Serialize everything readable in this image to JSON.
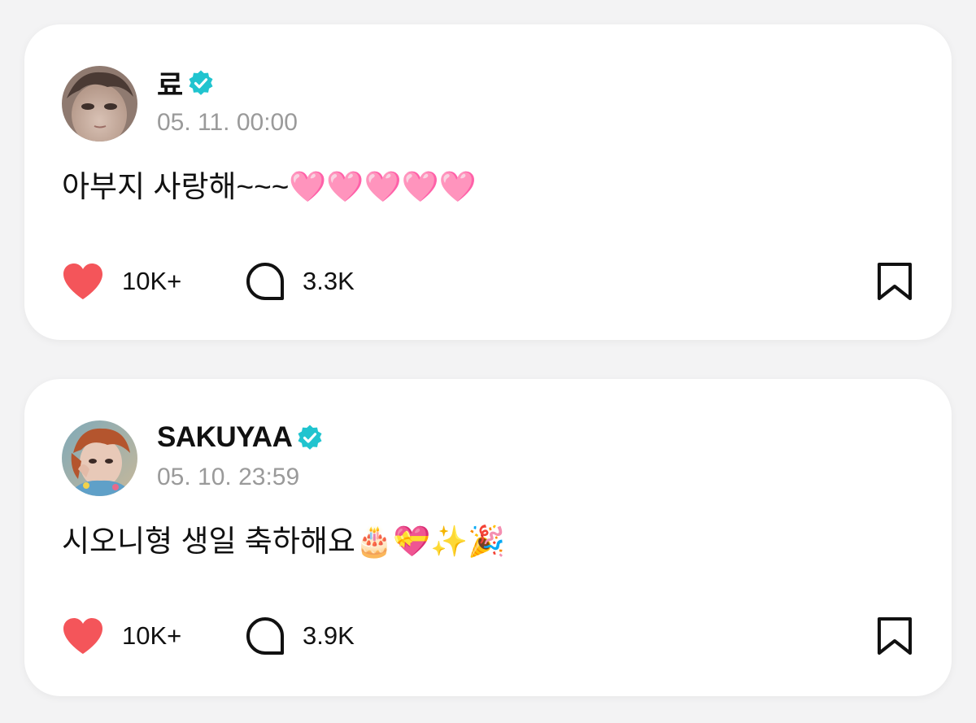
{
  "posts": [
    {
      "author": "료",
      "verified": true,
      "timestamp": "05. 11. 00:00",
      "text": "아부지 사랑해~~~🩷🩷🩷🩷🩷",
      "likes": "10K+",
      "comments": "3.3K"
    },
    {
      "author": "SAKUYAA",
      "verified": true,
      "timestamp": "05. 10. 23:59",
      "text": "시오니형 생일 축하해요🎂💝✨🎉",
      "likes": "10K+",
      "comments": "3.9K"
    }
  ],
  "colors": {
    "like": "#f4555a",
    "verified": "#20c4cf",
    "timestamp": "#9a9a9a",
    "background": "#f3f3f4"
  },
  "icons": {
    "like": "heart-icon",
    "comment": "comment-bubble-icon",
    "bookmark": "bookmark-icon",
    "verified": "verified-badge-icon"
  }
}
